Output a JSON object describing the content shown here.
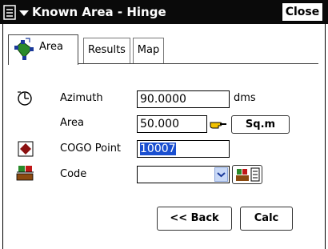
{
  "window": {
    "title": "Known Area - Hinge",
    "close_label": "Close"
  },
  "tabs": [
    {
      "label": "Area",
      "active": true
    },
    {
      "label": "Results",
      "active": false
    },
    {
      "label": "Map",
      "active": false
    }
  ],
  "form": {
    "azimuth": {
      "label": "Azimuth",
      "value": "90.0000",
      "unit": "dms"
    },
    "area": {
      "label": "Area",
      "value": "50.000",
      "unit_button": "Sq.m"
    },
    "cogo_point": {
      "label": "COGO Point",
      "value": "10007"
    },
    "code": {
      "label": "Code",
      "value": ""
    }
  },
  "buttons": {
    "back": "<< Back",
    "calc": "Calc"
  },
  "icons": {
    "menu": "menu-dropdown-icon",
    "tab_area": "area-polygon-icon",
    "azimuth": "compass-dial-icon",
    "area_pick": "pointing-hand-icon",
    "cogo": "red-diamond-icon",
    "code": "code-layers-icon",
    "code_list": "code-list-icon"
  },
  "colors": {
    "titlebar": "#0a0a0a",
    "selection": "#1a4fd0",
    "cogo_marker": "#8b1010",
    "area_icon": "#2a8a2a"
  }
}
